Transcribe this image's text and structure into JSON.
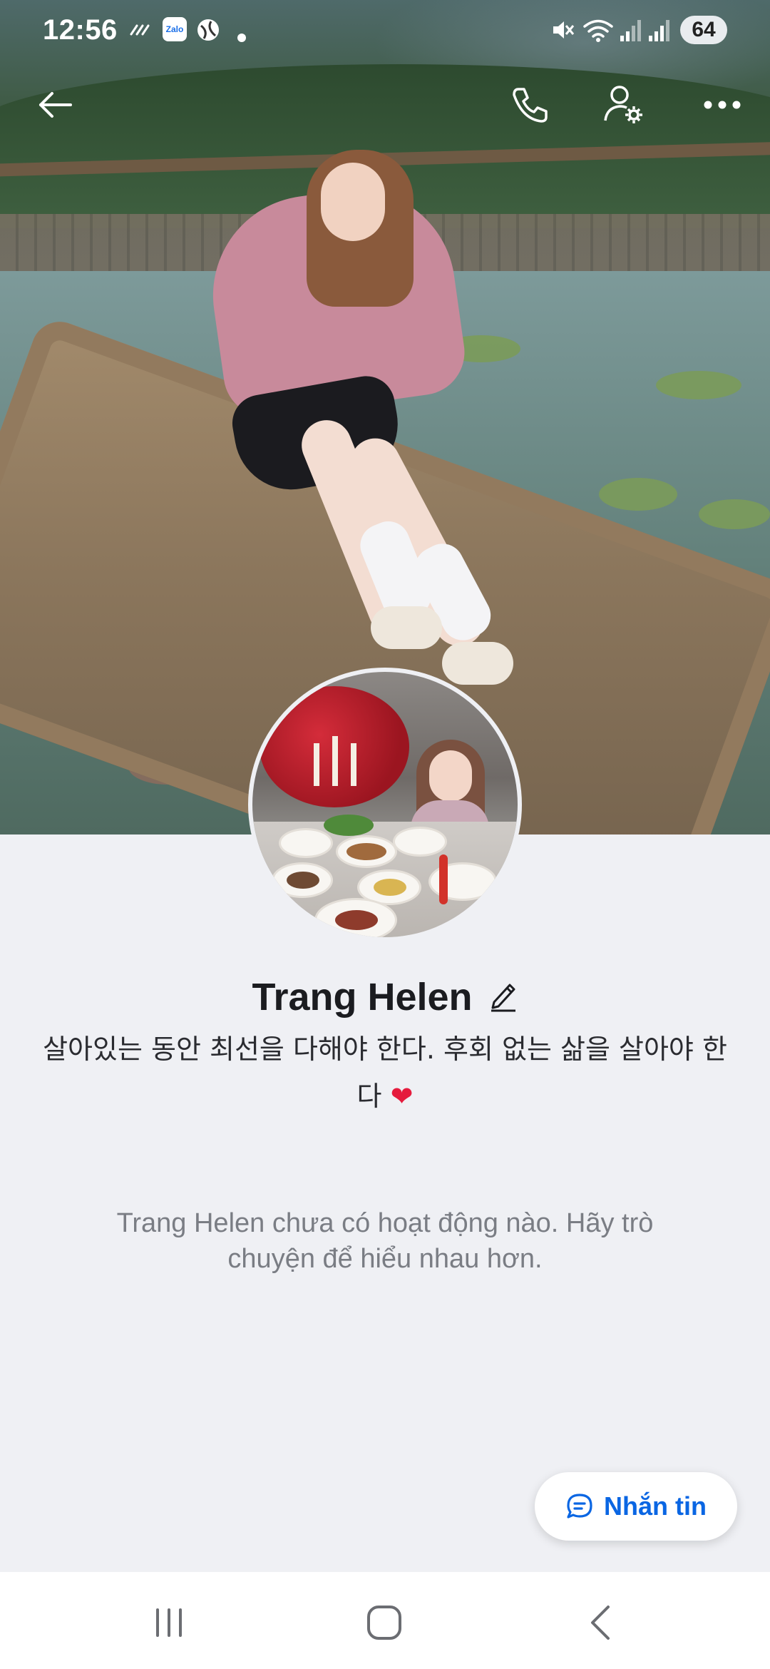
{
  "status_bar": {
    "time": "12:56",
    "zalo_label": "Zalo",
    "battery": "64",
    "icons": [
      "signal-dots-icon",
      "zalo-app-icon",
      "vpn-globe-icon",
      "dot-icon",
      "mute-icon",
      "wifi-icon",
      "cell-signal-icon",
      "cell-signal-icon"
    ]
  },
  "header": {
    "icons": [
      "back-arrow-icon",
      "phone-icon",
      "profile-settings-icon",
      "more-icon"
    ]
  },
  "profile": {
    "name": "Trang Helen",
    "bio_line1": "살아있는 동안 최선을 다해야 한다. 후회 없는 삶을 살아야 한",
    "bio_line2": "다",
    "bio_emoji": "❤",
    "empty_message": "Trang Helen chưa có hoạt động nào. Hãy trò chuyện để hiểu nhau hơn."
  },
  "actions": {
    "message_button": "Nhắn tin"
  },
  "colors": {
    "accent": "#0a66e3",
    "background": "#eff0f4",
    "heart": "#e51b3d"
  },
  "nav": {
    "icons": [
      "recent-apps-icon",
      "home-icon",
      "back-icon"
    ]
  }
}
